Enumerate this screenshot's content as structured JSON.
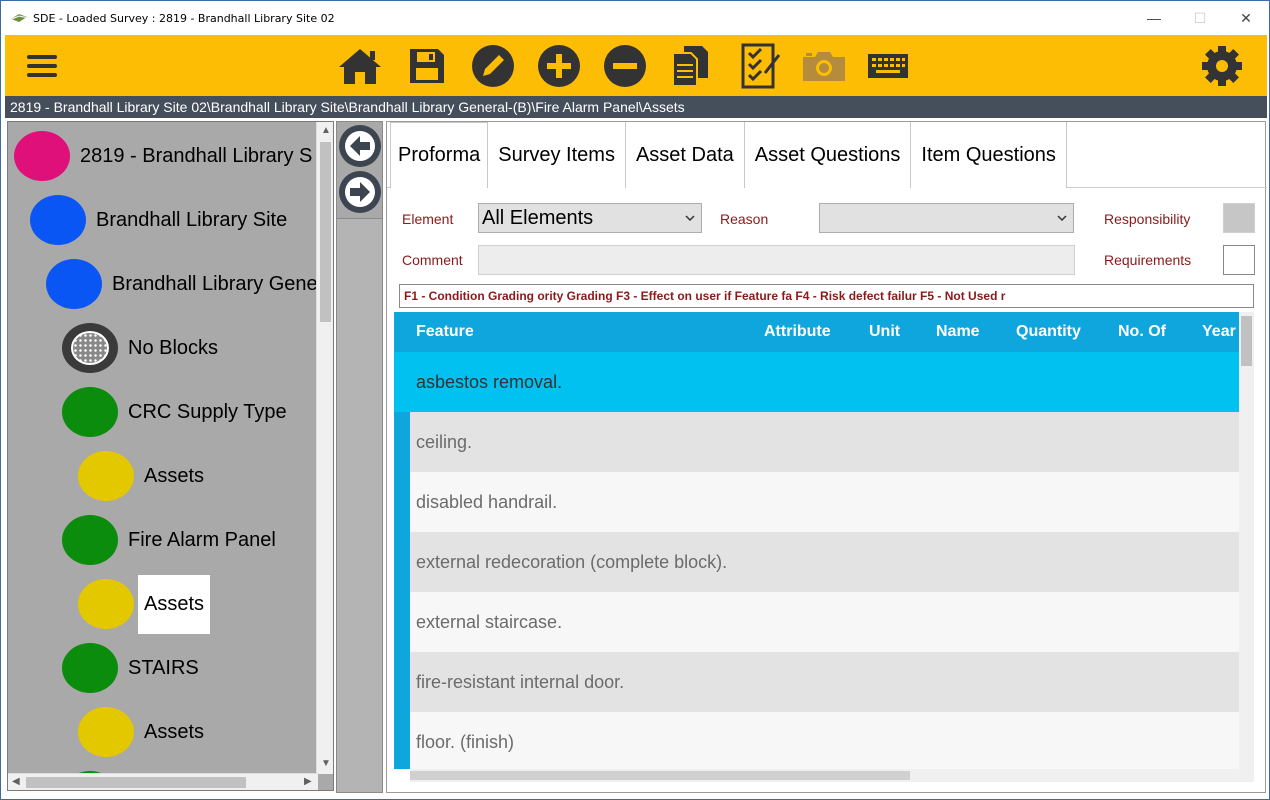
{
  "window": {
    "title": "SDE - Loaded Survey : 2819 - Brandhall Library Site 02",
    "minimize": "—",
    "maximize": "☐",
    "close": "✕"
  },
  "toolbar": {
    "menu_icon": "hamburger-menu-icon",
    "buttons": [
      "home-icon",
      "save-icon",
      "edit-icon",
      "add-icon",
      "remove-icon",
      "copy-documents-icon",
      "checklist-icon",
      "camera-icon",
      "keyboard-icon"
    ],
    "settings_icon": "gear-icon",
    "accent_color": "#fdbd05"
  },
  "breadcrumb": "2819 - Brandhall Library Site 02\\Brandhall Library Site\\Brandhall Library General-(B)\\Fire Alarm Panel\\Assets",
  "tree": {
    "items": [
      {
        "label": "2819 - Brandhall Library S",
        "color": "#e0107a"
      },
      {
        "label": "Brandhall Library Site",
        "color": "#0a56f5"
      },
      {
        "label": "Brandhall Library Gene",
        "color": "#0a56f5"
      },
      {
        "label": "No Blocks",
        "color": "#3a3a3a"
      },
      {
        "label": "CRC Supply Type",
        "color": "#0c8c0c"
      },
      {
        "label": "Assets",
        "color": "#e3c800"
      },
      {
        "label": "Fire Alarm Panel",
        "color": "#0c8c0c"
      },
      {
        "label": "Assets",
        "color": "#e3c800"
      },
      {
        "label": "STAIRS",
        "color": "#0c8c0c"
      },
      {
        "label": "Assets",
        "color": "#e3c800"
      }
    ]
  },
  "nav": {
    "back_icon": "arrow-left-icon",
    "forward_icon": "arrow-right-icon"
  },
  "tabs": [
    "Proforma",
    "Survey Items",
    "Asset Data",
    "Asset Questions",
    "Item Questions"
  ],
  "filters": {
    "element_label": "Element",
    "element_value": "All Elements",
    "reason_label": "Reason",
    "reason_value": "",
    "responsibility_label": "Responsibility",
    "comment_label": "Comment",
    "requirements_label": "Requirements"
  },
  "fkeys": "F1 - Condition Grading  ority Grading  F3 - Effect on user if Feature fa F4 - Risk defect failur F5 - Not Used r",
  "grid": {
    "columns": [
      "Feature",
      "Attribute",
      "Unit",
      "Name",
      "Quantity",
      "No. Of",
      "Year"
    ],
    "rows": [
      "asbestos removal.",
      "ceiling.",
      "disabled handrail.",
      "external redecoration (complete block).",
      "external staircase.",
      "fire-resistant internal door.",
      "floor. (finish)"
    ],
    "selected_row": 0,
    "header_color": "#0fa6dd",
    "selected_color": "#00c1f0"
  }
}
